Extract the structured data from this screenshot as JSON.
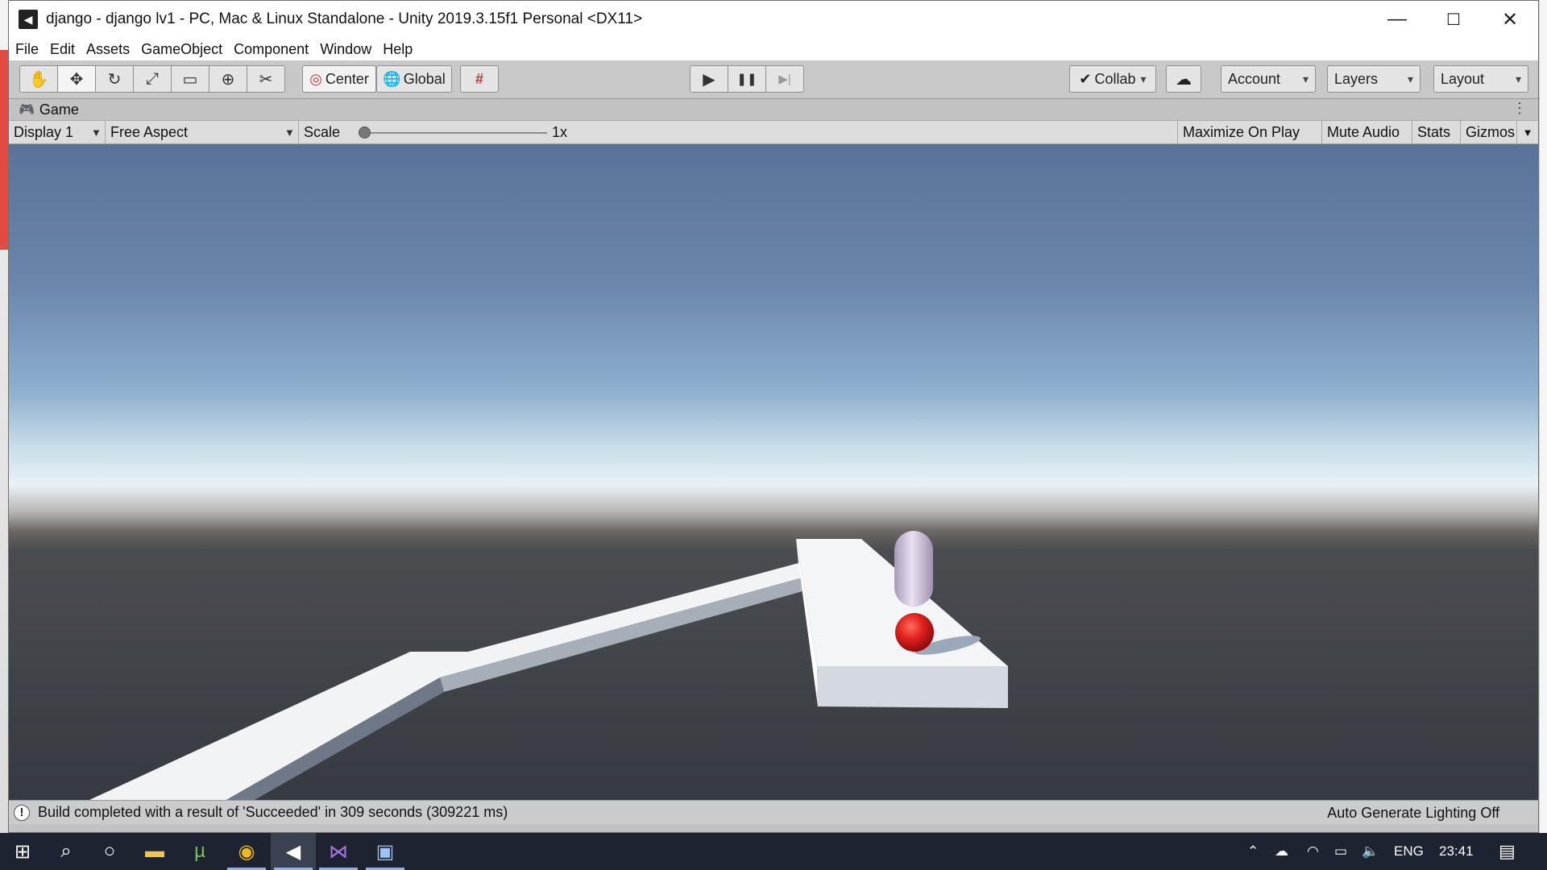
{
  "window": {
    "title": "django - django lv1 - PC, Mac & Linux Standalone - Unity 2019.3.15f1 Personal <DX11>",
    "controls": {
      "minimize": "—",
      "maximize": "☐",
      "close": "✕"
    }
  },
  "menu": [
    "File",
    "Edit",
    "Assets",
    "GameObject",
    "Component",
    "Window",
    "Help"
  ],
  "toolbar": {
    "tools": [
      {
        "name": "hand-tool",
        "glyph": "✋"
      },
      {
        "name": "move-tool",
        "glyph": "✥"
      },
      {
        "name": "rotate-tool",
        "glyph": "↻"
      },
      {
        "name": "scale-tool",
        "glyph": "⤢"
      },
      {
        "name": "rect-tool",
        "glyph": "▭"
      },
      {
        "name": "transform-tool",
        "glyph": "⊕"
      },
      {
        "name": "custom-tool",
        "glyph": "✂"
      }
    ],
    "pivot_label": "Center",
    "space_label": "Global",
    "snap_glyph": "#",
    "play_glyph": "▶",
    "pause_glyph": "❚❚",
    "step_glyph": "▶|",
    "collab_label": "Collab",
    "cloud_glyph": "☁",
    "account_label": "Account",
    "layers_label": "Layers",
    "layout_label": "Layout"
  },
  "game_tab": {
    "label": "Game",
    "menu_glyph": "⋮"
  },
  "game_bar": {
    "display": "Display 1",
    "aspect": "Free Aspect",
    "scale_label": "Scale",
    "scale_value": "1x",
    "maximize": "Maximize On Play",
    "mute": "Mute Audio",
    "stats": "Stats",
    "gizmos": "Gizmos"
  },
  "status": {
    "message": "Build completed with a result of 'Succeeded' in 309 seconds (309221 ms)",
    "lighting": "Auto Generate Lighting Off"
  },
  "taskbar": {
    "apps": [
      "windows-start",
      "search",
      "cortana",
      "file-explorer",
      "utorrent",
      "chrome",
      "unity",
      "visual-studio",
      "unity-hub"
    ],
    "tray": {
      "language": "ENG",
      "time": "23:41"
    }
  },
  "colors": {
    "sky_top": "#59729a",
    "horizon": "#e9f1f6",
    "ground": "#3a3f44",
    "ball": "#e0211e",
    "capsule": "#c9bcd7"
  }
}
